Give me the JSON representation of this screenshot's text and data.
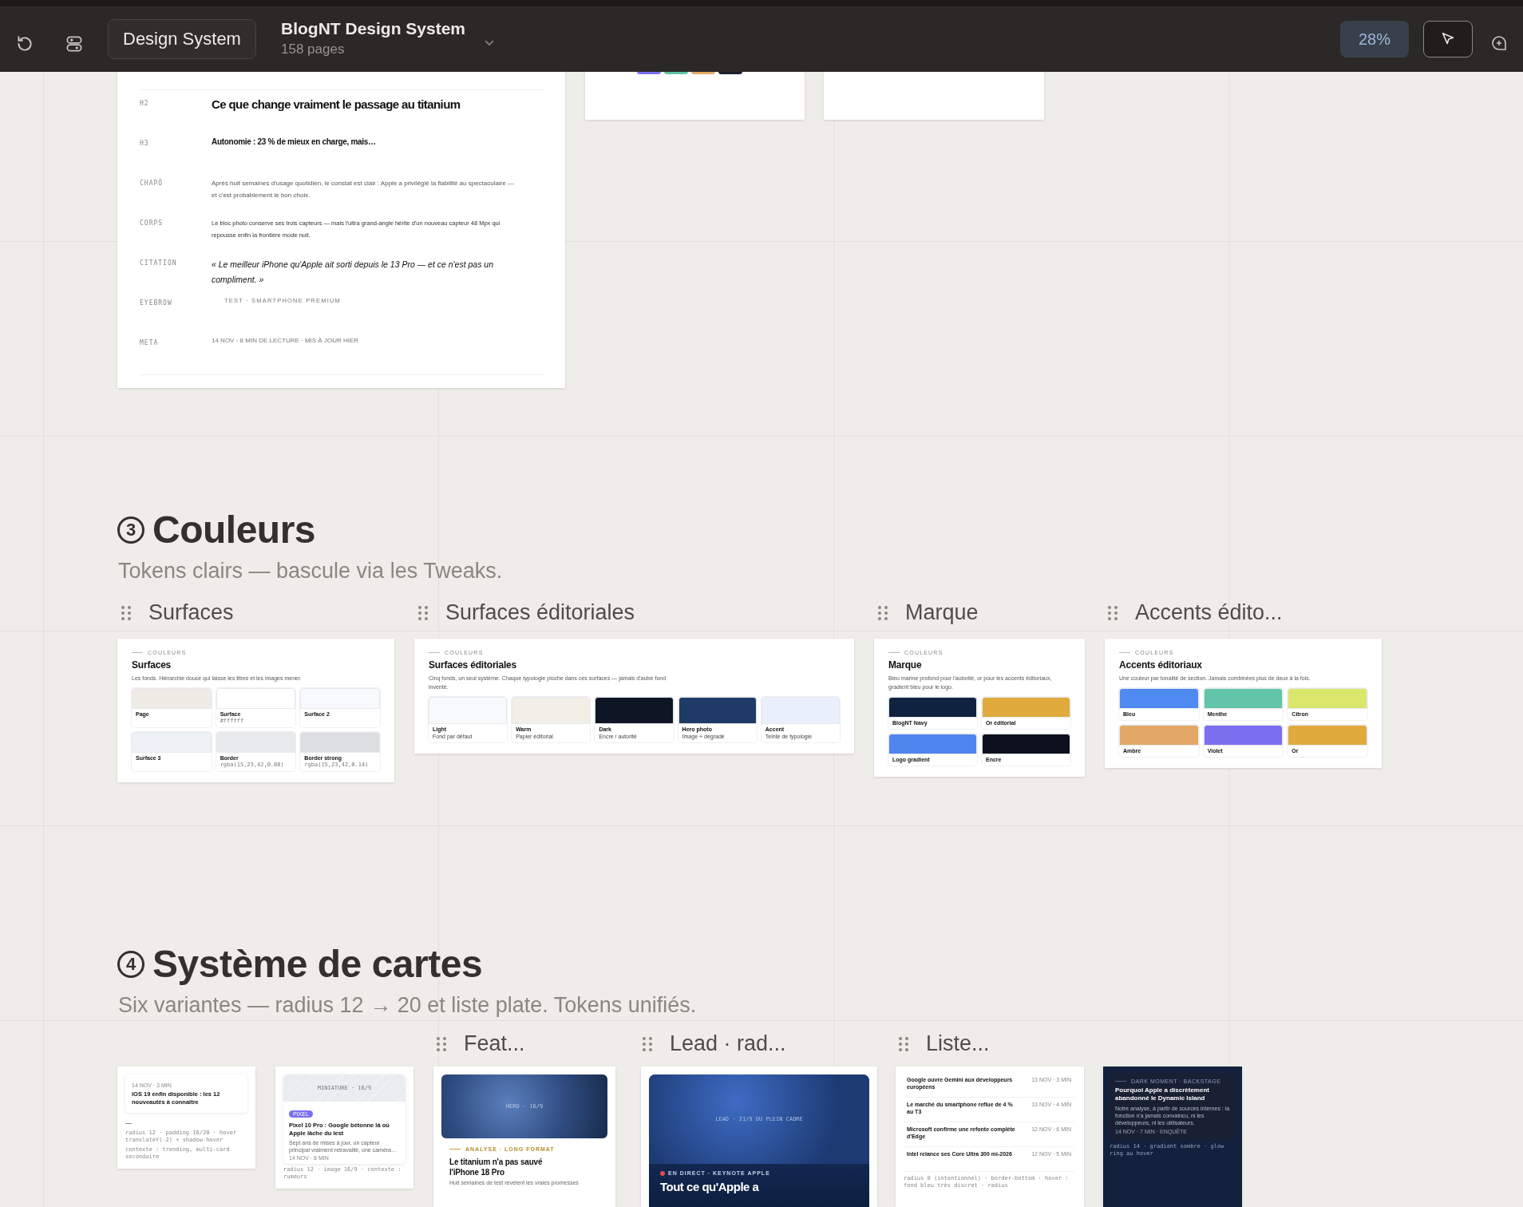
{
  "toolbar": {
    "file_button": "Design System",
    "title": "BlogNT Design System",
    "subtitle": "158 pages",
    "zoom": "28%"
  },
  "typography": {
    "rows": [
      {
        "kind": "h2",
        "label": "H2",
        "sample": "Ce que change vraiment le passage au titanium"
      },
      {
        "kind": "h3",
        "label": "H3",
        "sample": "Autonomie : 23 % de mieux en charge, mais…"
      },
      {
        "kind": "chapo",
        "label": "CHAPÔ",
        "sample": "Après huit semaines d'usage quotidien, le constat est clair : Apple a privilégié la fiabilité au spectaculaire — et c'est probablement le bon choix."
      },
      {
        "kind": "corps",
        "label": "CORPS",
        "sample": "Le bloc photo conserve ses trois capteurs — mais l'ultra grand-angle hérite d'un nouveau capteur 48 Mpx qui repousse enfin la frontière mode nuit."
      },
      {
        "kind": "citation",
        "label": "CITATION",
        "sample": "« Le meilleur iPhone qu'Apple ait sorti depuis le 13 Pro — et ce n'est pas un compliment. »"
      },
      {
        "kind": "eyebrow",
        "label": "EYEBROW",
        "sample": "TEST · SMARTPHONE PREMIUM"
      },
      {
        "kind": "meta",
        "label": "META",
        "sample": "14 NOV · 8 MIN DE LECTURE · MIS À JOUR HIER"
      }
    ]
  },
  "colors": {
    "number": "3",
    "title": "Couleurs",
    "subtitle": "Tokens clairs — bascule via les Tweaks.",
    "frames": [
      {
        "label": "Surfaces",
        "kind": "grid",
        "eyebrow": "COULEURS",
        "title": "Surfaces",
        "description": "Les fonds. Hiérarchie douce qui laisse les titres et les images mener.",
        "swatches": [
          {
            "name": "Page",
            "color": "#efece6"
          },
          {
            "name": "Surface",
            "color": "#ffffff",
            "value": "#ffffff"
          },
          {
            "name": "Surface 2",
            "color": "#f8f9fc"
          },
          {
            "name": "Surface 3",
            "color": "#eef2f7"
          },
          {
            "name": "Border",
            "color": "#e9eaec",
            "value": "rgba(15,23,42,0.08)"
          },
          {
            "name": "Border strong",
            "color": "#dcdde0",
            "value": "rgba(15,23,42,0.14)"
          }
        ]
      },
      {
        "label": "Surfaces éditoriales",
        "kind": "strip",
        "eyebrow": "COULEURS",
        "title": "Surfaces éditoriales",
        "description": "Cinq fonds, un seul système. Chaque typologie pioche dans ces surfaces — jamais d'autre fond inventé.",
        "swatches": [
          {
            "name": "Light",
            "note": "Fond par défaut",
            "color": "#f8f9fb"
          },
          {
            "name": "Warm",
            "note": "Papier éditorial",
            "color": "#f2efe6"
          },
          {
            "name": "Dark",
            "note": "Encre / autorité",
            "color": "#0e1626"
          },
          {
            "name": "Hero photo",
            "note": "Image + dégradé",
            "color": "#1f3a66"
          },
          {
            "name": "Accent",
            "note": "Teinte de typologie",
            "color": "#eaf0fb"
          }
        ]
      },
      {
        "label": "Marque",
        "kind": "grid2",
        "eyebrow": "COULEURS",
        "title": "Marque",
        "description": "Bleu marine profond pour l'autorité, or pour les accents éditoriaux, gradient bleu pour le logo.",
        "swatches": [
          {
            "name": "BlogNT Navy",
            "color": "#0f2240"
          },
          {
            "name": "Or éditorial",
            "color": "#e0ab3c"
          },
          {
            "name": "Logo gradient",
            "color": "#4f86ee"
          },
          {
            "name": "Encre",
            "color": "#0b101c"
          }
        ]
      },
      {
        "label": "Accents édito...",
        "kind": "grid",
        "eyebrow": "COULEURS",
        "title": "Accents éditoriaux",
        "description": "Une couleur par tonalité de section. Jamais combinées plus de deux à la fois.",
        "swatches": [
          {
            "name": "Bleu",
            "color": "#4f8af0"
          },
          {
            "name": "Menthe",
            "color": "#62c4a8"
          },
          {
            "name": "Citron",
            "color": "#dbe76a"
          },
          {
            "name": "Ambre",
            "color": "#e3a866"
          },
          {
            "name": "Violet",
            "color": "#7b6ff0"
          },
          {
            "name": "Or",
            "color": "#e0ab3c"
          }
        ]
      }
    ]
  },
  "cards": {
    "number": "4",
    "title": "Système de cartes",
    "subtitle": "Six variantes — radius 12 → 20 et liste plate. Tokens unifiés.",
    "labels": [
      "Feat...",
      "Lead · rad...",
      "Liste..."
    ],
    "items": [
      {
        "kind": "compact",
        "meta": "14 NOV · 3 MIN",
        "title": "iOS 19 enfin disponible : les 12 nouveautés à connaître",
        "dash": "—",
        "spec": "radius 12 · padding 16/20 · hover translateY(-2) + shadow-hover",
        "context": "contexte : trending, multi-card secondaire"
      },
      {
        "kind": "thumb",
        "image_label": "MINIATURE · 16/9",
        "tag": "PIXEL",
        "title": "Pixel 10 Pro : Google bétonne là où Apple lâche du lest",
        "excerpt": "Sept ans de mises à jour, un capteur principal vraiment retravaillé, une caméra…",
        "meta": "14 NOV · 8 MIN",
        "spec": "radius 12 · image 16/9 · contexte : rumeurs"
      },
      {
        "kind": "feature",
        "image_label": "HERO · 16/9",
        "eyebrow": "ANALYSE · LONG FORMAT",
        "title": "Le titanium n'a pas sauvé l'iPhone 18 Pro",
        "excerpt": "Huit semaines de test révèlent les vraies promesses"
      },
      {
        "kind": "lead",
        "image_label": "LEAD · 21/9 OU PLEIN CADRE",
        "eyebrow": "EN DIRECT · KEYNOTE APPLE",
        "title": "Tout ce qu'Apple a"
      },
      {
        "kind": "list",
        "rows": [
          {
            "title": "Google ouvre Gemini aux développeurs européens",
            "meta": "13 NOV · 3 MIN"
          },
          {
            "title": "Le marché du smartphone reflue de 4 % au T3",
            "meta": "13 NOV · 4 MIN"
          },
          {
            "title": "Microsoft confirme une refonte complète d'Edge",
            "meta": "12 NOV · 6 MIN"
          },
          {
            "title": "Intel relance ses Core Ultra 300 mi-2026",
            "meta": "12 NOV · 5 MIN"
          }
        ],
        "spec": "radius 8 (intentionnel) · border-bottom · hover : fond bleu très discret · radius"
      },
      {
        "kind": "dark",
        "eyebrow": "DARK MOMENT · BACKSTAGE",
        "title": "Pourquoi Apple a discrètement abandonné le Dynamic Island",
        "excerpt": "Notre analyse, à partir de sources internes : la fonction n'a jamais convaincu, ni les développeurs, ni les utilisateurs.",
        "meta": "14 NOV · 7 MIN · ENQUÊTE",
        "spec": "radius 14 · gradient sombre · glow ring au hover"
      }
    ]
  }
}
